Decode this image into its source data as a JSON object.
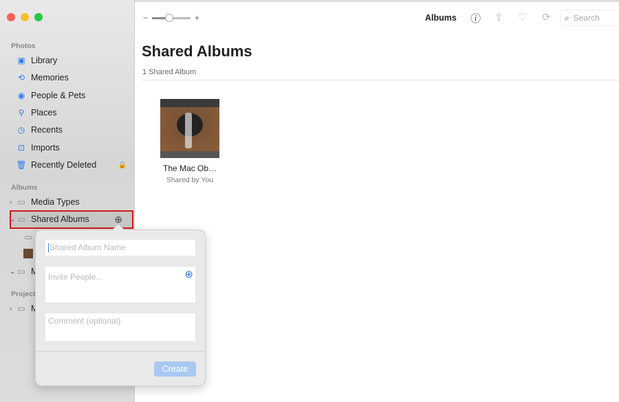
{
  "colors": {
    "accent": "#2f7cf6",
    "highlight": "#d0191a",
    "close": "#fe5f57",
    "minimize": "#febc2e",
    "zoom": "#28c840"
  },
  "sidebar": {
    "photos_header": "Photos",
    "items": [
      {
        "label": "Library",
        "icon": "photo-library-icon"
      },
      {
        "label": "Memories",
        "icon": "memories-icon"
      },
      {
        "label": "People & Pets",
        "icon": "person-icon"
      },
      {
        "label": "Places",
        "icon": "pin-icon"
      },
      {
        "label": "Recents",
        "icon": "clock-icon"
      },
      {
        "label": "Imports",
        "icon": "import-icon"
      },
      {
        "label": "Recently Deleted",
        "icon": "trash-icon"
      }
    ],
    "albums_header": "Albums",
    "albums": [
      {
        "label": "Media Types"
      },
      {
        "label": "Shared Albums"
      },
      {
        "label": "M"
      }
    ],
    "projects_header": "Project",
    "projects": [
      {
        "label": "M"
      }
    ]
  },
  "toolbar": {
    "zoom_minus": "−",
    "zoom_plus": "+",
    "zoom_level": 0.45,
    "title": "Albums",
    "search_placeholder": "Search"
  },
  "main": {
    "title": "Shared Albums",
    "count": "1 Shared Album",
    "album": {
      "name": "The Mac Ob…",
      "subtitle": "Shared by You"
    }
  },
  "popover": {
    "name_placeholder": "Shared Album Name",
    "invite_placeholder": "Invite People...",
    "comment_placeholder": "Comment (optional)",
    "create_label": "Create"
  }
}
